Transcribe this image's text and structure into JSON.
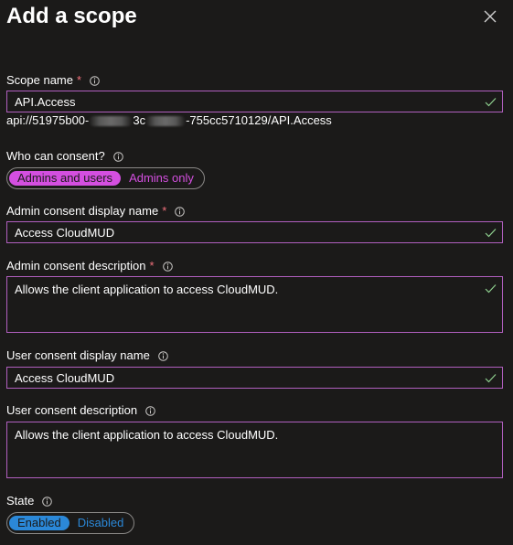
{
  "panel": {
    "title": "Add a scope"
  },
  "scope_name": {
    "label": "Scope name",
    "required_mark": "*",
    "value": "API.Access",
    "uri_prefix": "api://51975b00-",
    "uri_middle": "3c",
    "uri_suffix": "-755cc5710129/API.Access"
  },
  "who_can_consent": {
    "label": "Who can consent?",
    "options": [
      "Admins and users",
      "Admins only"
    ],
    "selected": "Admins and users"
  },
  "admin_display_name": {
    "label": "Admin consent display name",
    "required_mark": "*",
    "value": "Access CloudMUD"
  },
  "admin_description": {
    "label": "Admin consent description",
    "required_mark": "*",
    "value": "Allows the client application to access CloudMUD."
  },
  "user_display_name": {
    "label": "User consent display name",
    "value": "Access CloudMUD"
  },
  "user_description": {
    "label": "User consent description",
    "value": "Allows the client application to access CloudMUD."
  },
  "state": {
    "label": "State",
    "options": [
      "Enabled",
      "Disabled"
    ],
    "selected": "Enabled"
  },
  "icons": {
    "close": "close-icon",
    "info": "info-icon",
    "valid": "checkmark-icon"
  },
  "colors": {
    "background": "#1b1a19",
    "field_border": "#b15fbf",
    "consent_accent": "#d44fe0",
    "state_accent": "#2b88d8",
    "required": "#f1707b",
    "valid_check": "#8fd08f"
  }
}
